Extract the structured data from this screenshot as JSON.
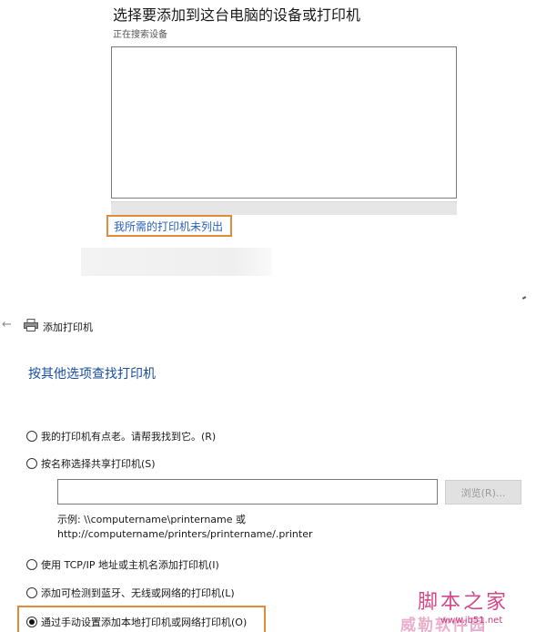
{
  "top_panel": {
    "title": "选择要添加到这台电脑的设备或打印机",
    "status": "正在搜索设备",
    "not_listed_link": "我所需的打印机未列出"
  },
  "dialog": {
    "back_icon": "back-arrow-icon",
    "printer_icon": "printer-icon",
    "title": "添加打印机",
    "heading": "按其他选项查找打印机",
    "options": [
      {
        "label": "我的打印机有点老。请帮我找到它。(R)",
        "checked": false
      },
      {
        "label": "按名称选择共享打印机(S)",
        "checked": false
      },
      {
        "label": "使用 TCP/IP 地址或主机名添加打印机(I)",
        "checked": false
      },
      {
        "label": "添加可检测到蓝牙、无线或网络的打印机(L)",
        "checked": false
      },
      {
        "label": "通过手动设置添加本地打印机或网络打印机(O)",
        "checked": true
      }
    ],
    "share_input_value": "",
    "browse_button": "浏览(R)...",
    "example_line1": "示例: \\\\computername\\printername 或",
    "example_line2": "http://computername/printers/printername/.printer"
  },
  "watermark": {
    "text": "脚本之家",
    "text2": "威勒软件园",
    "url": "www.jb51.net"
  },
  "colors": {
    "highlight": "#e08a3a",
    "link": "#2a63b8",
    "heading": "#1a4fa0"
  }
}
